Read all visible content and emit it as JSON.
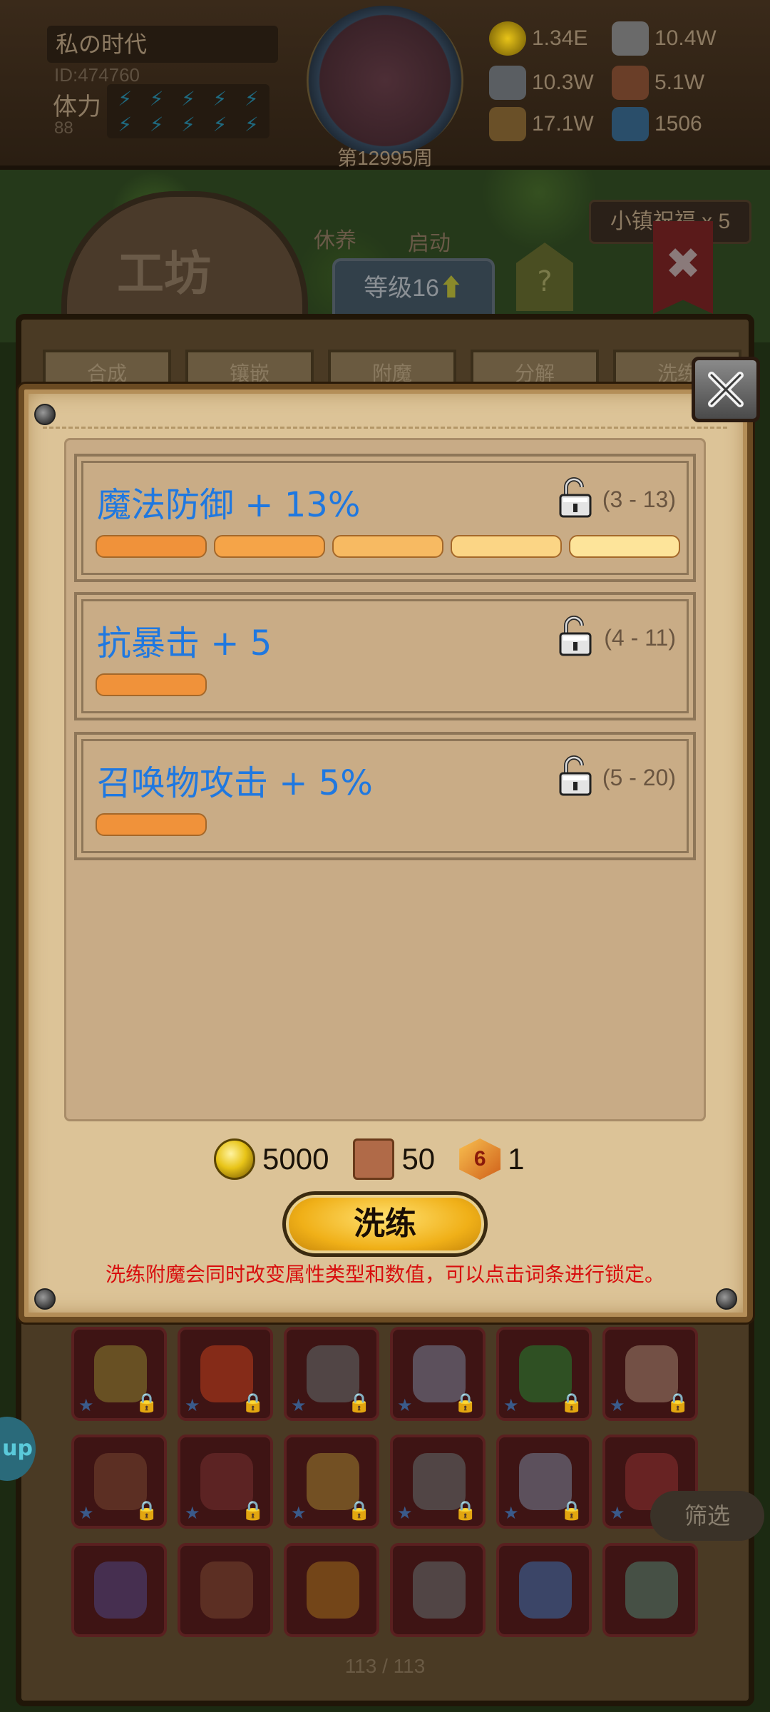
{
  "header": {
    "player_name": "私の时代",
    "player_id": "ID:474760",
    "stamina_label": "体力",
    "stamina_value": "88",
    "week": "第12995周",
    "resources": [
      {
        "icon": "gold-coin-icon",
        "value": "1.34E"
      },
      {
        "icon": "iron-ingot-icon",
        "value": "10.4W"
      },
      {
        "icon": "stone-ore-icon",
        "value": "10.3W"
      },
      {
        "icon": "leather-icon",
        "value": "5.1W"
      },
      {
        "icon": "wood-log-icon",
        "value": "17.1W"
      },
      {
        "icon": "crystal-icon",
        "value": "1506"
      }
    ]
  },
  "background": {
    "town_blessing": "小镇祝福 x 5",
    "workshop_title": "工坊",
    "level": "等级16",
    "help": "?",
    "building_labels": [
      "休养",
      "启动"
    ],
    "tabs": [
      "合成",
      "镶嵌",
      "附魔",
      "分解",
      "洗练"
    ],
    "filter_button": "筛选",
    "page_count": "113 / 113",
    "side_button": "up"
  },
  "modal": {
    "attributes": [
      {
        "name": "魔法防御 + 13%",
        "range": "(3 - 13)",
        "bars": 5
      },
      {
        "name": "抗暴击 + 5",
        "range": "(4 - 11)",
        "bars": 1
      },
      {
        "name": "召唤物攻击 + 5%",
        "range": "(5 - 20)",
        "bars": 1
      }
    ],
    "costs": [
      {
        "icon": "gold-coin-icon",
        "value": "5000"
      },
      {
        "icon": "scroll-icon",
        "value": "50"
      },
      {
        "icon": "d6-gem-icon",
        "value": "1",
        "glyph": "6"
      }
    ],
    "refine_button": "洗练",
    "hint": "洗练附魔会同时改变属性类型和数值，可以点击词条进行锁定。"
  },
  "colors": {
    "attr_text": "#1f78e0",
    "hint_text": "#d80e0e",
    "bar_colors": [
      "#f0923a",
      "#f5a448",
      "#f7ba62",
      "#fbd585",
      "#fde49a"
    ]
  }
}
